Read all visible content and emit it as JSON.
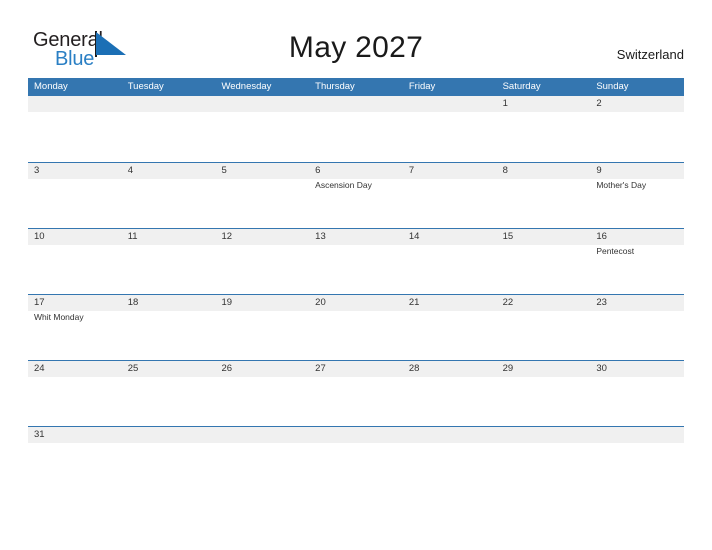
{
  "brand": {
    "word_one": "General",
    "word_two": "Blue",
    "triangle_icon": "triangle-icon",
    "accent_blue": "#2a7fc4",
    "text_dark": "#231f20"
  },
  "header": {
    "title": "May 2027",
    "location": "Switzerland"
  },
  "theme": {
    "header_blue": "#3476b0",
    "row_shade": "#f0f0f0",
    "rule_blue": "#3476b0",
    "text": "#333333"
  },
  "calendar": {
    "weekdays": [
      "Monday",
      "Tuesday",
      "Wednesday",
      "Thursday",
      "Friday",
      "Saturday",
      "Sunday"
    ],
    "weeks": [
      [
        {
          "day": "",
          "events": []
        },
        {
          "day": "",
          "events": []
        },
        {
          "day": "",
          "events": []
        },
        {
          "day": "",
          "events": []
        },
        {
          "day": "",
          "events": []
        },
        {
          "day": "1",
          "events": []
        },
        {
          "day": "2",
          "events": []
        }
      ],
      [
        {
          "day": "3",
          "events": []
        },
        {
          "day": "4",
          "events": []
        },
        {
          "day": "5",
          "events": []
        },
        {
          "day": "6",
          "events": [
            "Ascension Day"
          ]
        },
        {
          "day": "7",
          "events": []
        },
        {
          "day": "8",
          "events": []
        },
        {
          "day": "9",
          "events": [
            "Mother's Day"
          ]
        }
      ],
      [
        {
          "day": "10",
          "events": []
        },
        {
          "day": "11",
          "events": []
        },
        {
          "day": "12",
          "events": []
        },
        {
          "day": "13",
          "events": []
        },
        {
          "day": "14",
          "events": []
        },
        {
          "day": "15",
          "events": []
        },
        {
          "day": "16",
          "events": [
            "Pentecost"
          ]
        }
      ],
      [
        {
          "day": "17",
          "events": [
            "Whit Monday"
          ]
        },
        {
          "day": "18",
          "events": []
        },
        {
          "day": "19",
          "events": []
        },
        {
          "day": "20",
          "events": []
        },
        {
          "day": "21",
          "events": []
        },
        {
          "day": "22",
          "events": []
        },
        {
          "day": "23",
          "events": []
        }
      ],
      [
        {
          "day": "24",
          "events": []
        },
        {
          "day": "25",
          "events": []
        },
        {
          "day": "26",
          "events": []
        },
        {
          "day": "27",
          "events": []
        },
        {
          "day": "28",
          "events": []
        },
        {
          "day": "29",
          "events": []
        },
        {
          "day": "30",
          "events": []
        }
      ],
      [
        {
          "day": "31",
          "events": []
        },
        {
          "day": "",
          "events": []
        },
        {
          "day": "",
          "events": []
        },
        {
          "day": "",
          "events": []
        },
        {
          "day": "",
          "events": []
        },
        {
          "day": "",
          "events": []
        },
        {
          "day": "",
          "events": []
        }
      ]
    ]
  }
}
